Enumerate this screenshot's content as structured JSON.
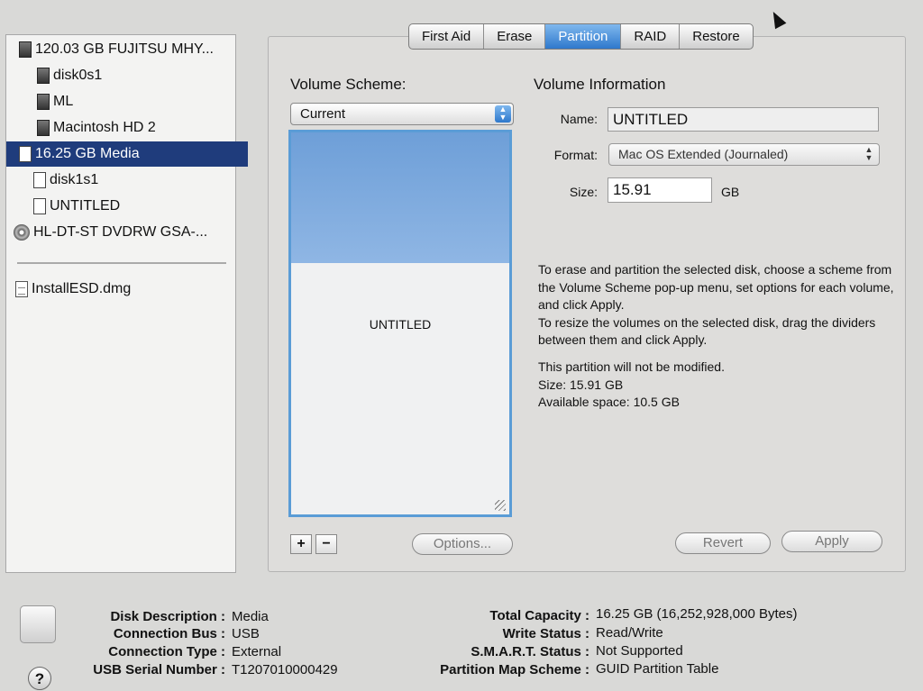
{
  "sidebar": {
    "items": [
      {
        "label": "120.03 GB FUJITSU MHY...",
        "icon": "hard-disk-icon",
        "indent": 0,
        "selected": false
      },
      {
        "label": "disk0s1",
        "icon": "volume-icon",
        "indent": 1,
        "selected": false
      },
      {
        "label": "ML",
        "icon": "volume-icon",
        "indent": 1,
        "selected": false
      },
      {
        "label": "Macintosh HD 2",
        "icon": "volume-icon",
        "indent": 1,
        "selected": false
      },
      {
        "label": "16.25 GB Media",
        "icon": "usb-disk-icon",
        "indent": 0,
        "selected": true
      },
      {
        "label": "disk1s1",
        "icon": "volume-icon",
        "indent": 1,
        "selected": false
      },
      {
        "label": "UNTITLED",
        "icon": "volume-icon",
        "indent": 1,
        "selected": false
      },
      {
        "label": "HL-DT-ST DVDRW GSA-...",
        "icon": "optical-disc-icon",
        "indent": 0,
        "selected": false
      }
    ],
    "images": [
      {
        "label": "InstallESD.dmg",
        "icon": "disk-image-icon"
      }
    ]
  },
  "tabs": [
    {
      "label": "First Aid",
      "active": false
    },
    {
      "label": "Erase",
      "active": false
    },
    {
      "label": "Partition",
      "active": true
    },
    {
      "label": "RAID",
      "active": false
    },
    {
      "label": "Restore",
      "active": false
    }
  ],
  "volume_scheme": {
    "heading": "Volume Scheme:",
    "selected": "Current",
    "partition_label": "UNTITLED",
    "add_label": "+",
    "remove_label": "−",
    "options_label": "Options..."
  },
  "volume_info": {
    "heading": "Volume Information",
    "name_label": "Name:",
    "name_value": "UNTITLED",
    "format_label": "Format:",
    "format_value": "Mac OS Extended (Journaled)",
    "size_label": "Size:",
    "size_value": "15.91",
    "size_unit": "GB",
    "instructions_1": "To erase and partition the selected disk, choose a scheme from the Volume Scheme pop-up menu, set options for each volume, and click Apply.",
    "instructions_2": "To resize the volumes on the selected disk, drag the dividers between them and click Apply.",
    "status_line": "This partition will not be modified.",
    "status_size": "Size: 15.91 GB",
    "status_available": "Available space: 10.5 GB",
    "revert_label": "Revert",
    "apply_label": "Apply"
  },
  "disk_info": {
    "left": [
      {
        "label": "Disk Description :",
        "value": "Media"
      },
      {
        "label": "Connection Bus :",
        "value": "USB"
      },
      {
        "label": "Connection Type :",
        "value": "External"
      },
      {
        "label": "USB Serial Number :",
        "value": "T1207010000429"
      }
    ],
    "right": [
      {
        "label": "Total Capacity :",
        "value": "16.25 GB (16,252,928,000 Bytes)"
      },
      {
        "label": "Write Status :",
        "value": "Read/Write"
      },
      {
        "label": "S.M.A.R.T. Status :",
        "value": "Not Supported"
      },
      {
        "label": "Partition Map Scheme :",
        "value": "GUID Partition Table"
      }
    ]
  },
  "help_label": "?",
  "colors": {
    "selection": "#1f3c7c",
    "tab_active": "#2e78cc",
    "partition_blue": "#6e9fd8"
  }
}
